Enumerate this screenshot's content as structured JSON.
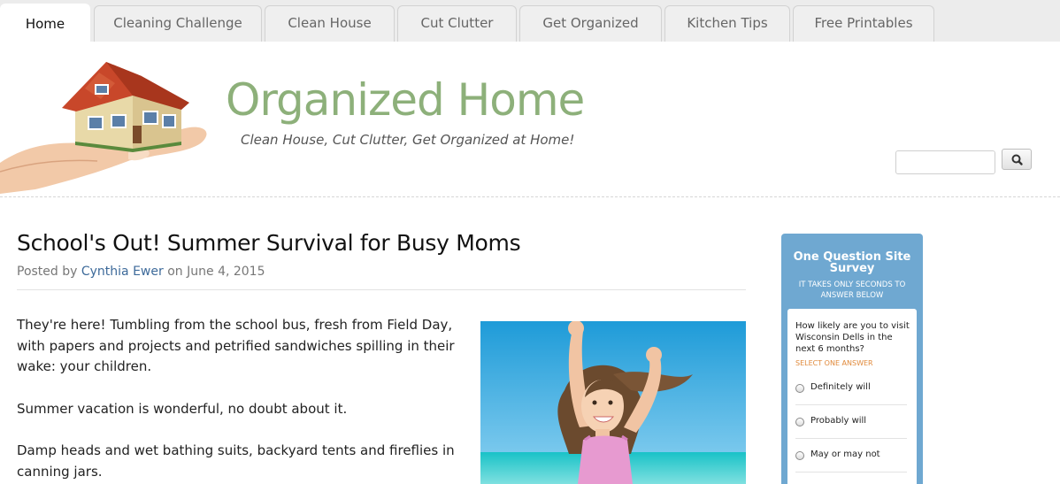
{
  "nav": {
    "tabs": [
      {
        "label": "Home",
        "active": true
      },
      {
        "label": "Cleaning Challenge",
        "active": false
      },
      {
        "label": "Clean House",
        "active": false
      },
      {
        "label": "Cut Clutter",
        "active": false
      },
      {
        "label": "Get Organized",
        "active": false
      },
      {
        "label": "Kitchen Tips",
        "active": false
      },
      {
        "label": "Free Printables",
        "active": false
      }
    ]
  },
  "header": {
    "site_title": "Organized Home",
    "tagline": "Clean House, Cut Clutter, Get Organized at Home!",
    "search_icon": "magnifier-icon"
  },
  "article": {
    "title": "School's Out! Summer Survival for Busy Moms",
    "byline_prefix": "Posted by",
    "author": "Cynthia Ewer",
    "byline_on": "on",
    "date": "June 4, 2015",
    "paragraphs": [
      "They're here! Tumbling from the school bus, fresh from Field Day, with papers and projects and petrified sandwiches spilling in their wake: your children.",
      "Summer vacation is wonderful, no doubt about it.",
      "Damp heads and wet bathing suits, backyard tents and fireflies in canning jars."
    ]
  },
  "survey": {
    "title": "One Question Site Survey",
    "subtitle": "IT TAKES ONLY SECONDS TO ANSWER BELOW",
    "question": "How likely are you to visit Wisconsin Dells in the next 6 months?",
    "hint": "SELECT ONE ANSWER",
    "options": [
      "Definitely will",
      "Probably will",
      "May or may not"
    ]
  },
  "colors": {
    "title_green": "#8db07a",
    "survey_blue": "#6fa8d1",
    "link_blue": "#3d6a9a",
    "hint_orange": "#e0893a"
  }
}
